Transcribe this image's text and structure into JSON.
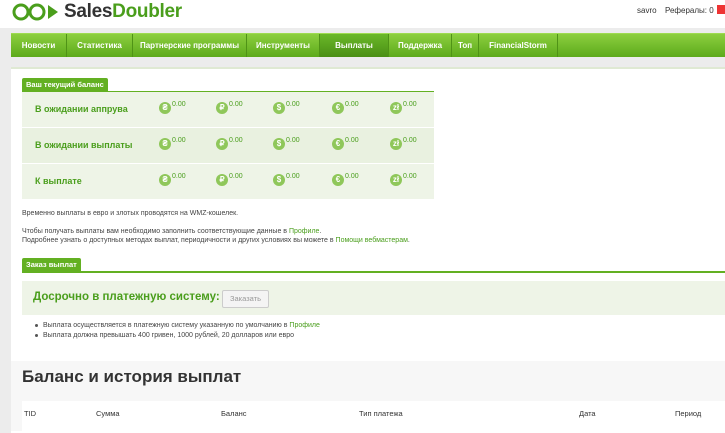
{
  "header": {
    "logo_prefix": "Sales",
    "logo_suffix": "Doubler",
    "username": "savro",
    "referrals": "Рефералы: 0"
  },
  "nav": {
    "items": [
      {
        "label": "Новости"
      },
      {
        "label": "Статистика"
      },
      {
        "label": "Партнерские программы"
      },
      {
        "label": "Инструменты"
      },
      {
        "label": "Выплаты"
      },
      {
        "label": "Поддержка"
      },
      {
        "label": "Топ"
      },
      {
        "label": "FinancialStorm"
      }
    ],
    "active": "Выплаты"
  },
  "balance": {
    "section_title": "Ваш текущий баланс",
    "currencies": [
      "uah-icon",
      "rub-icon",
      "usd-icon",
      "eur-icon",
      "pln-icon"
    ],
    "rows": [
      {
        "label": "В ожидании аппрува",
        "values": [
          "0.00",
          "0.00",
          "0.00",
          "0.00",
          "0.00"
        ]
      },
      {
        "label": "В ожидании выплаты",
        "values": [
          "0.00",
          "0.00",
          "0.00",
          "0.00",
          "0.00"
        ]
      },
      {
        "label": "К выплате",
        "values": [
          "0.00",
          "0.00",
          "0.00",
          "0.00",
          "0.00"
        ]
      }
    ]
  },
  "notes": {
    "line1": "Временно выплаты в евро и злотых проводятся на WMZ-кошелек.",
    "line2_pre": "Чтобы получать выплаты вам необходимо заполнить соответствующие данные в ",
    "line2_link": "Профиле",
    "line2_post": ".",
    "line3_pre": "Подробнее узнать о доступных методах выплат, периодичности и других условиях вы можете в ",
    "line3_link": "Помощи вебмастерам",
    "line3_post": "."
  },
  "order": {
    "section_title": "Заказ выплат",
    "title": "Досрочно в платежную систему:",
    "button": "Заказать",
    "bullet1_pre": "Выплата осуществляется в платежную систему указанную по умолчанию в ",
    "bullet1_link": "Профиле",
    "bullet2": "Выплата должна превышать 400 гривен, 1000 рублей, 20 долларов или евро"
  },
  "history": {
    "title": "Баланс и история выплат",
    "columns": [
      "TID",
      "Сумма",
      "Баланс",
      "Тип платежа",
      "Дата",
      "Период"
    ]
  },
  "colors": {
    "brand": "#4a9e1c",
    "nav": "#6ab829"
  }
}
